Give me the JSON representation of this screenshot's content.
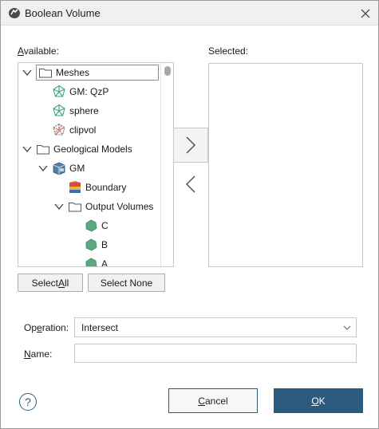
{
  "window": {
    "title": "Boolean Volume"
  },
  "available": {
    "label_underlined": "A",
    "label_rest": "vailable:",
    "tree": [
      {
        "label": "Meshes",
        "icon": "folder-icon",
        "chevron": "down"
      },
      {
        "label": "GM: QzP",
        "icon": "mesh-icon"
      },
      {
        "label": "sphere",
        "icon": "mesh-icon"
      },
      {
        "label": "clipvol",
        "icon": "mesh-hatched-icon"
      },
      {
        "label": "Geological Models",
        "icon": "folder-icon",
        "chevron": "down"
      },
      {
        "label": "GM",
        "icon": "geomodel-icon",
        "chevron": "down"
      },
      {
        "label": "Boundary",
        "icon": "boundary-icon"
      },
      {
        "label": "Output Volumes",
        "icon": "folder-icon",
        "chevron": "down"
      },
      {
        "label": "C",
        "icon": "volume-icon"
      },
      {
        "label": "B",
        "icon": "volume-icon"
      },
      {
        "label": "A",
        "icon": "volume-icon"
      }
    ]
  },
  "selected": {
    "label": "Selected:"
  },
  "buttons": {
    "select_all_pre": "Select ",
    "select_all_u": "A",
    "select_all_post": "ll",
    "select_none": "Select None",
    "cancel_u": "C",
    "cancel_rest": "ancel",
    "ok_u": "O",
    "ok_rest": "K"
  },
  "operation": {
    "label_pre": "Op",
    "label_u": "e",
    "label_post": "ration:",
    "value": "Intersect"
  },
  "name": {
    "label_u": "N",
    "label_rest": "ame:",
    "value": ""
  },
  "colors": {
    "accent": "#2b5b7c",
    "mesh": "#3aa27a",
    "volume": "#5aa880"
  }
}
